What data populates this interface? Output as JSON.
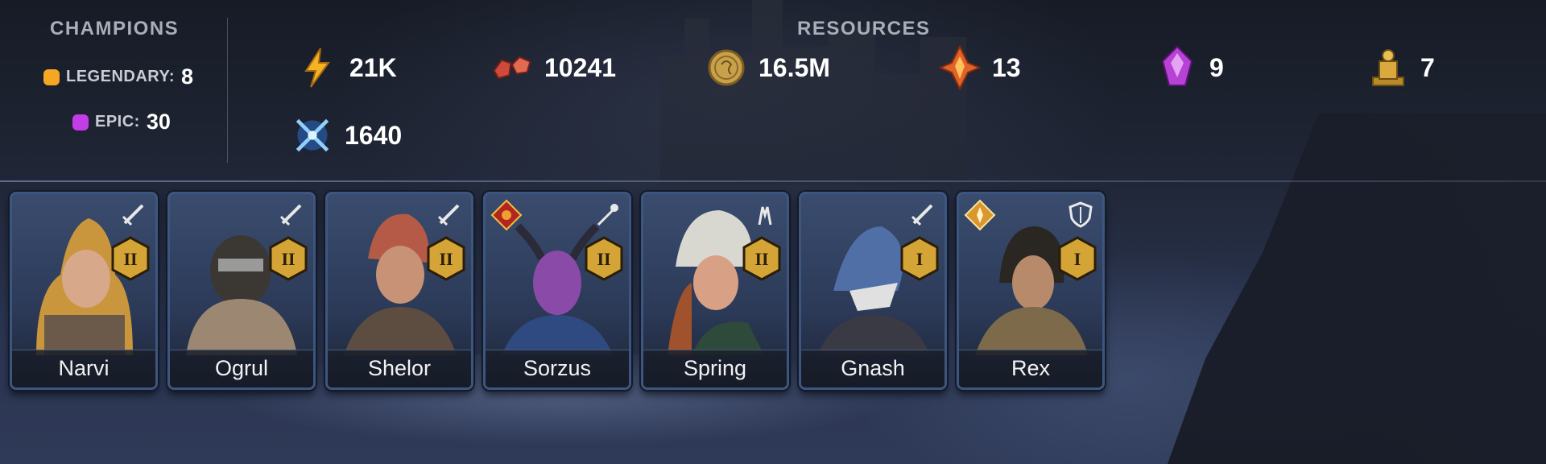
{
  "champions": {
    "title": "CHAMPIONS",
    "rarities": [
      {
        "label": "LEGENDARY:",
        "count": "8",
        "color": "#f5a623"
      },
      {
        "label": "EPIC:",
        "count": "30",
        "color": "#c23de8"
      }
    ]
  },
  "resources": {
    "title": "RESOURCES",
    "items": [
      {
        "icon": "energy-icon",
        "value": "21K"
      },
      {
        "icon": "gems-icon",
        "value": "10241"
      },
      {
        "icon": "silver-coin-icon",
        "value": "16.5M"
      },
      {
        "icon": "fire-shard-icon",
        "value": "13"
      },
      {
        "icon": "purple-shard-icon",
        "value": "9"
      },
      {
        "icon": "gold-statue-icon",
        "value": "7"
      },
      {
        "icon": "arena-token-icon",
        "value": "1640"
      }
    ]
  },
  "cards": [
    {
      "name": "Narvi",
      "role": "attack-icon",
      "rank": "II",
      "affinity": ""
    },
    {
      "name": "Ogrul",
      "role": "attack-icon",
      "rank": "II",
      "affinity": ""
    },
    {
      "name": "Shelor",
      "role": "attack-icon",
      "rank": "II",
      "affinity": ""
    },
    {
      "name": "Sorzus",
      "role": "magic-icon",
      "rank": "II",
      "affinity": "force-affinity-icon"
    },
    {
      "name": "Spring",
      "role": "support-icon",
      "rank": "II",
      "affinity": ""
    },
    {
      "name": "Gnash",
      "role": "attack-icon",
      "rank": "I",
      "affinity": ""
    },
    {
      "name": "Rex",
      "role": "defense-icon",
      "rank": "I",
      "affinity": "spirit-affinity-icon"
    }
  ],
  "colors": {
    "rank_gold": "#d4a437",
    "card_border": "#3d5680"
  }
}
